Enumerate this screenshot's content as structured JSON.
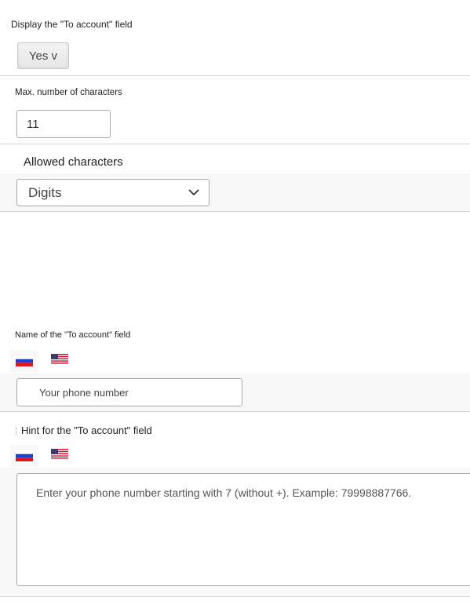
{
  "to_account_display": {
    "label": "Display the \"To account\" field",
    "value": "Yes v"
  },
  "max_chars": {
    "label": "Max. number of characters",
    "value": "11"
  },
  "allowed_chars": {
    "label": "Allowed characters",
    "value": "Digits"
  },
  "field_name": {
    "label": "Name of the \"To account\" field",
    "value": "Your phone number"
  },
  "field_hint": {
    "label": "Hint for the \"To account\" field",
    "value": "Enter your phone number starting with 7 (without +). Example: 79998887766."
  },
  "languages": [
    "russian-flag",
    "us-flag"
  ],
  "colors": {
    "divider": "#d4d4d4",
    "input_border": "#a9a9a9",
    "band": "#f8f8f8"
  }
}
